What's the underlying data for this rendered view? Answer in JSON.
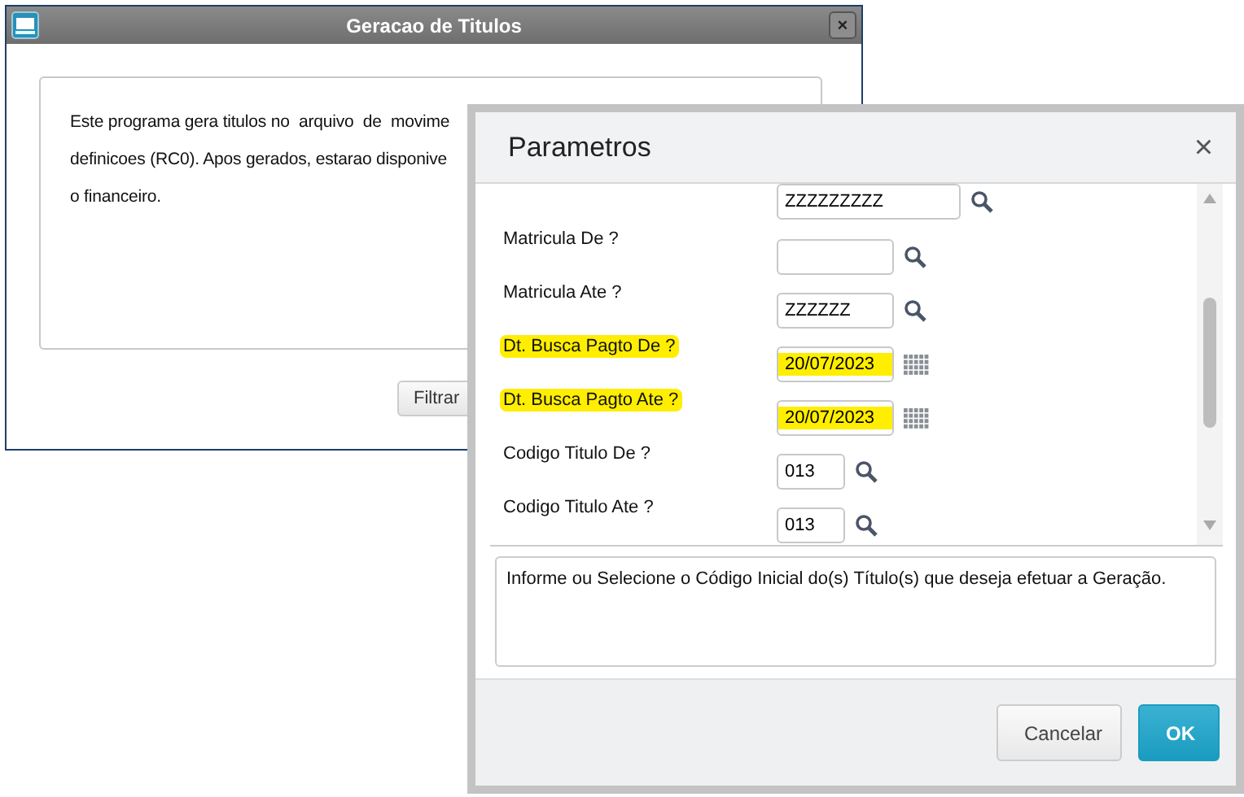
{
  "main_window": {
    "title": "Geracao de Titulos",
    "close": "×",
    "text_lines": [
      "Este programa gera titulos no  arquivo  de  movime",
      "definicoes (RC0). Apos gerados, estarao disponive",
      "o financeiro."
    ],
    "buttons": [
      "Filtrar"
    ]
  },
  "dialog": {
    "title": "Parametros",
    "close": "×",
    "params": [
      {
        "kind": "long_lookup",
        "value": "ZZZZZZZZZ",
        "highlighted": false
      },
      {
        "label": "Matricula De ?",
        "kind": "lookup",
        "highlighted": false
      },
      {
        "label": "Matricula Ate ?",
        "kind": "lookup",
        "value": "ZZZZZZ",
        "highlighted": false
      },
      {
        "label": "Dt. Busca Pagto De ?",
        "kind": "date",
        "value": "20/07/2023",
        "highlighted": true
      },
      {
        "label": "Dt. Busca Pagto Ate ?",
        "kind": "date",
        "value": "20/07/2023",
        "highlighted": true
      },
      {
        "label": "Codigo Titulo De ?",
        "kind": "code",
        "value": "013",
        "highlighted": false
      },
      {
        "label": "Codigo Titulo Ate ?",
        "kind": "code",
        "value": "013",
        "highlighted": false
      }
    ],
    "help_text": "Informe ou Selecione o Código Inicial do(s)  Título(s) que deseja efetuar a Geração.",
    "buttons": [
      {
        "label": "Cancelar",
        "kind": "secondary"
      },
      {
        "label": "OK",
        "kind": "primary"
      }
    ]
  }
}
